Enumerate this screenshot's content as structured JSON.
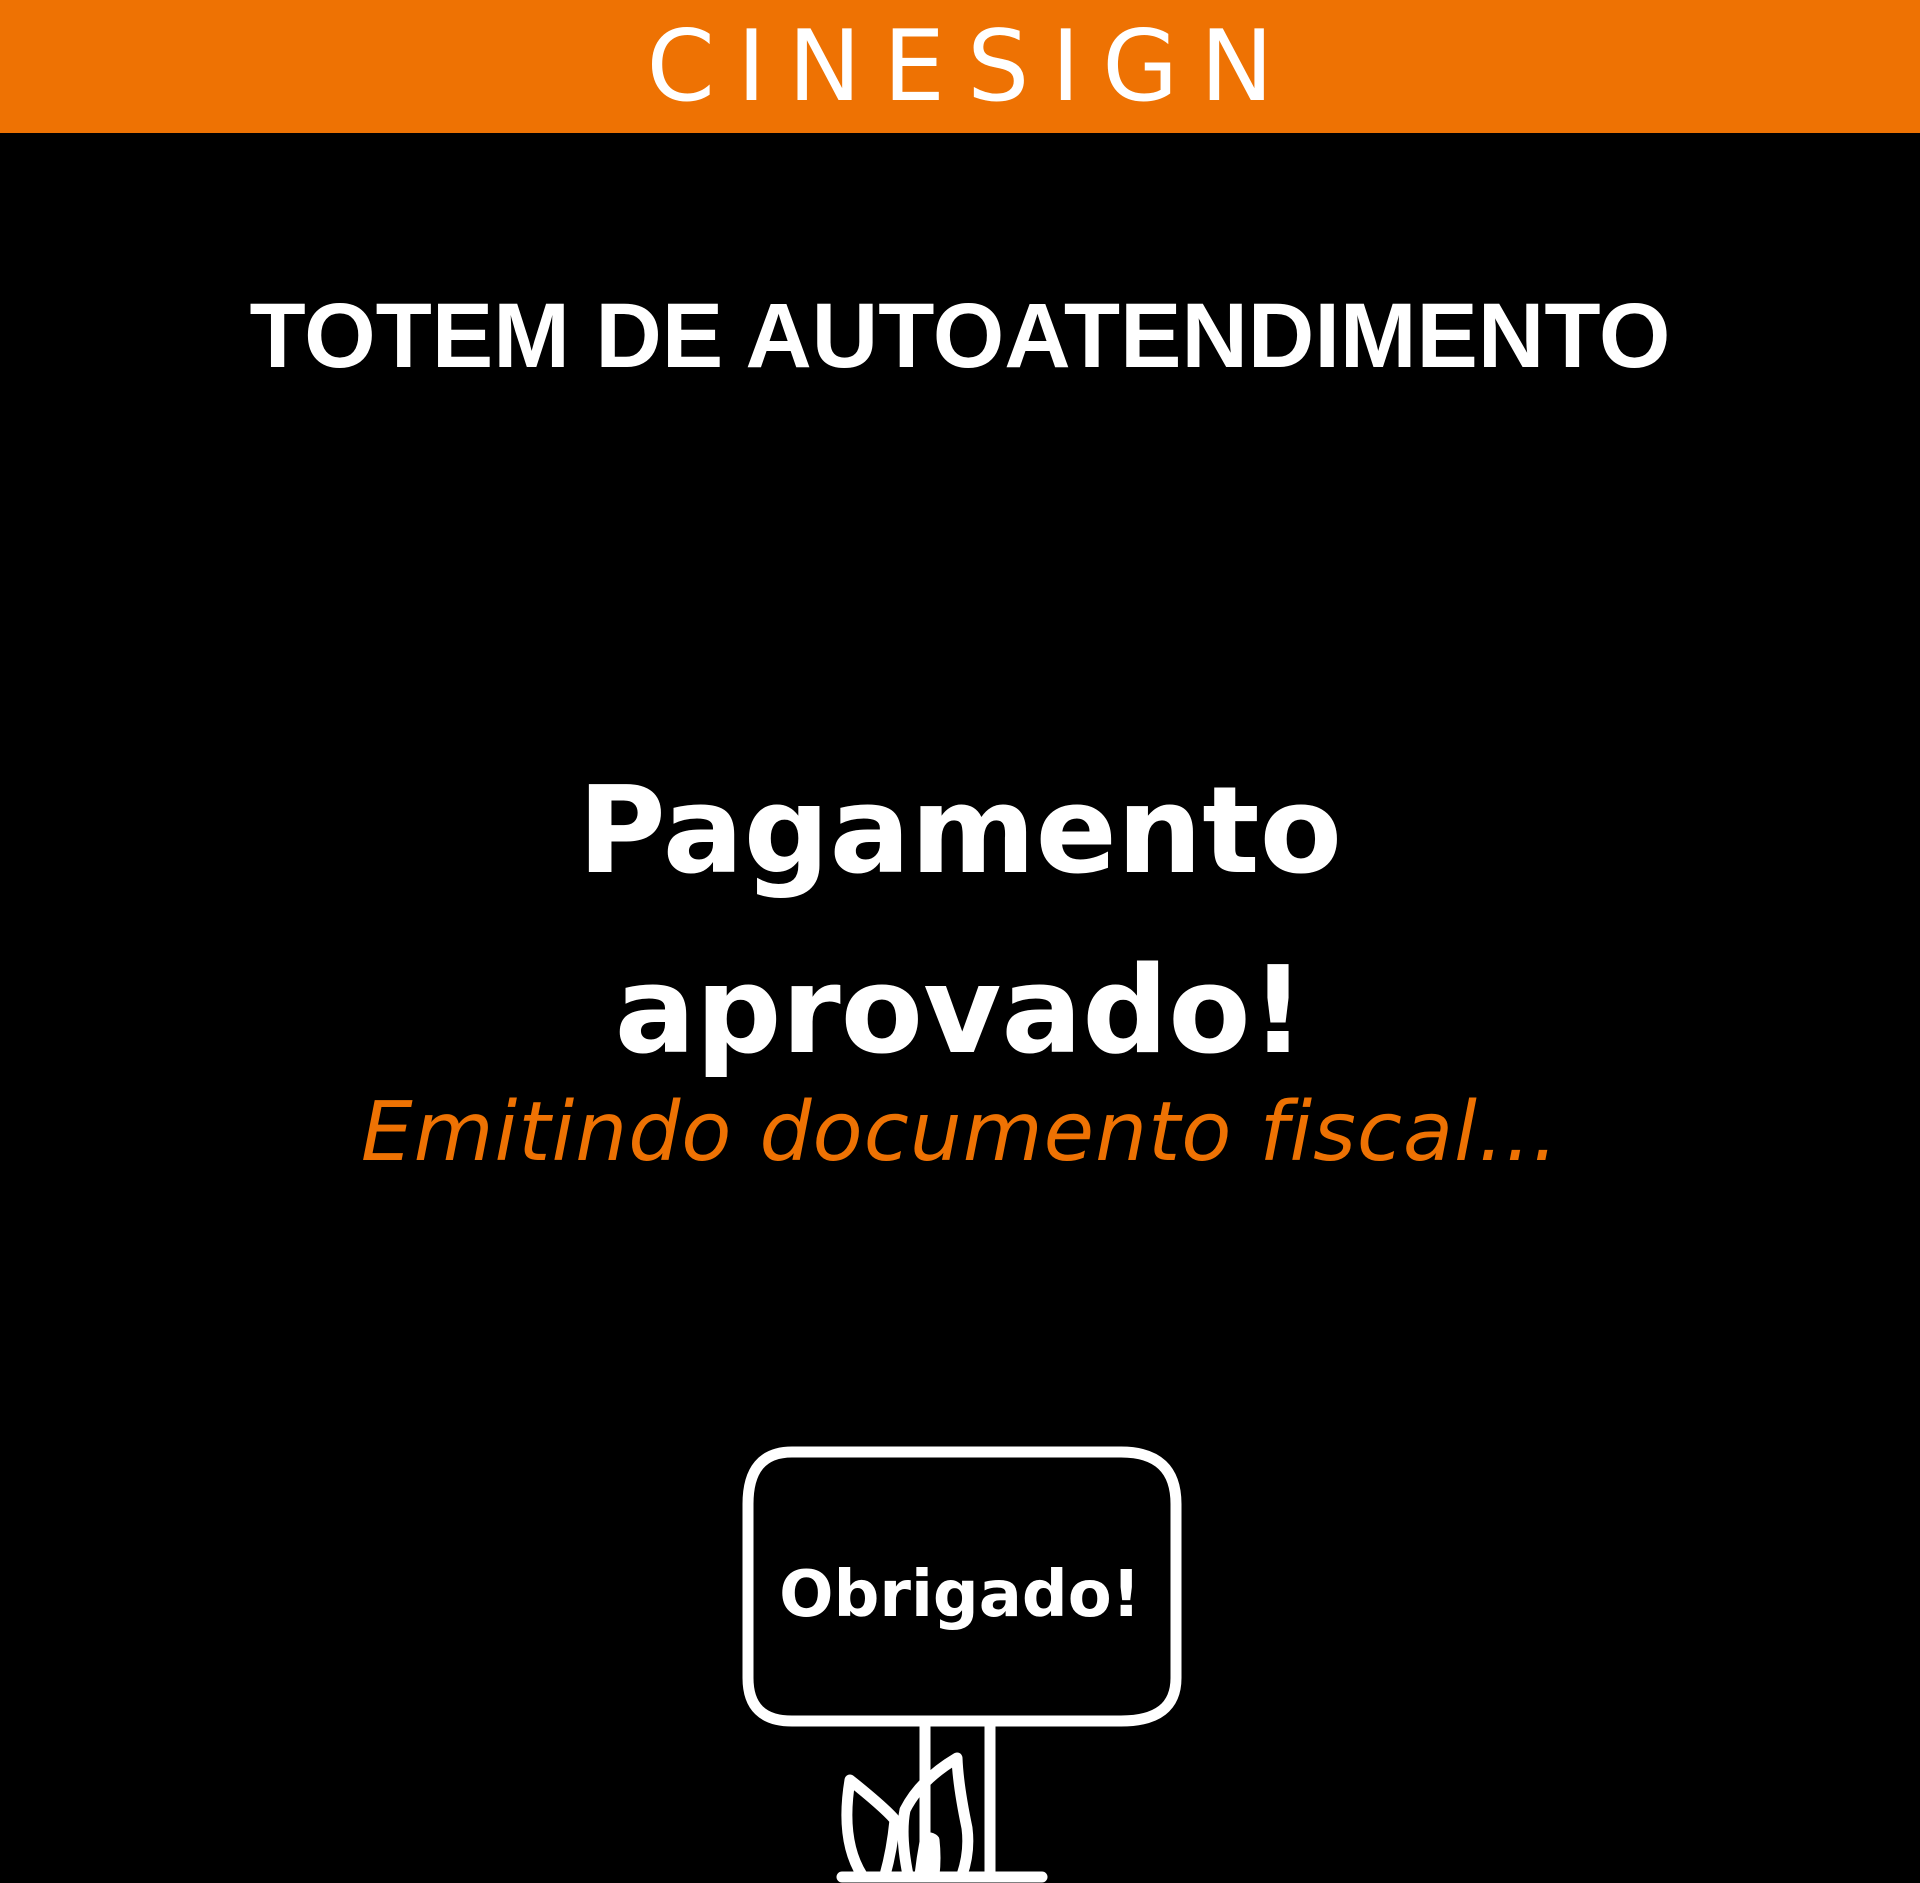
{
  "header": {
    "brand": "CINESIGN",
    "background_color": "#EE7203"
  },
  "main": {
    "kiosk_title": "TOTEM DE AUTOATENDIMENTO",
    "status_line_1": "Pagamento",
    "status_line_2": "aprovado!",
    "status_subtitle": "Emitindo documento fiscal...",
    "accent_color": "#EE7203"
  },
  "illustration": {
    "icon": "thank-you-sign-icon",
    "sign_text": "Obrigado!"
  }
}
